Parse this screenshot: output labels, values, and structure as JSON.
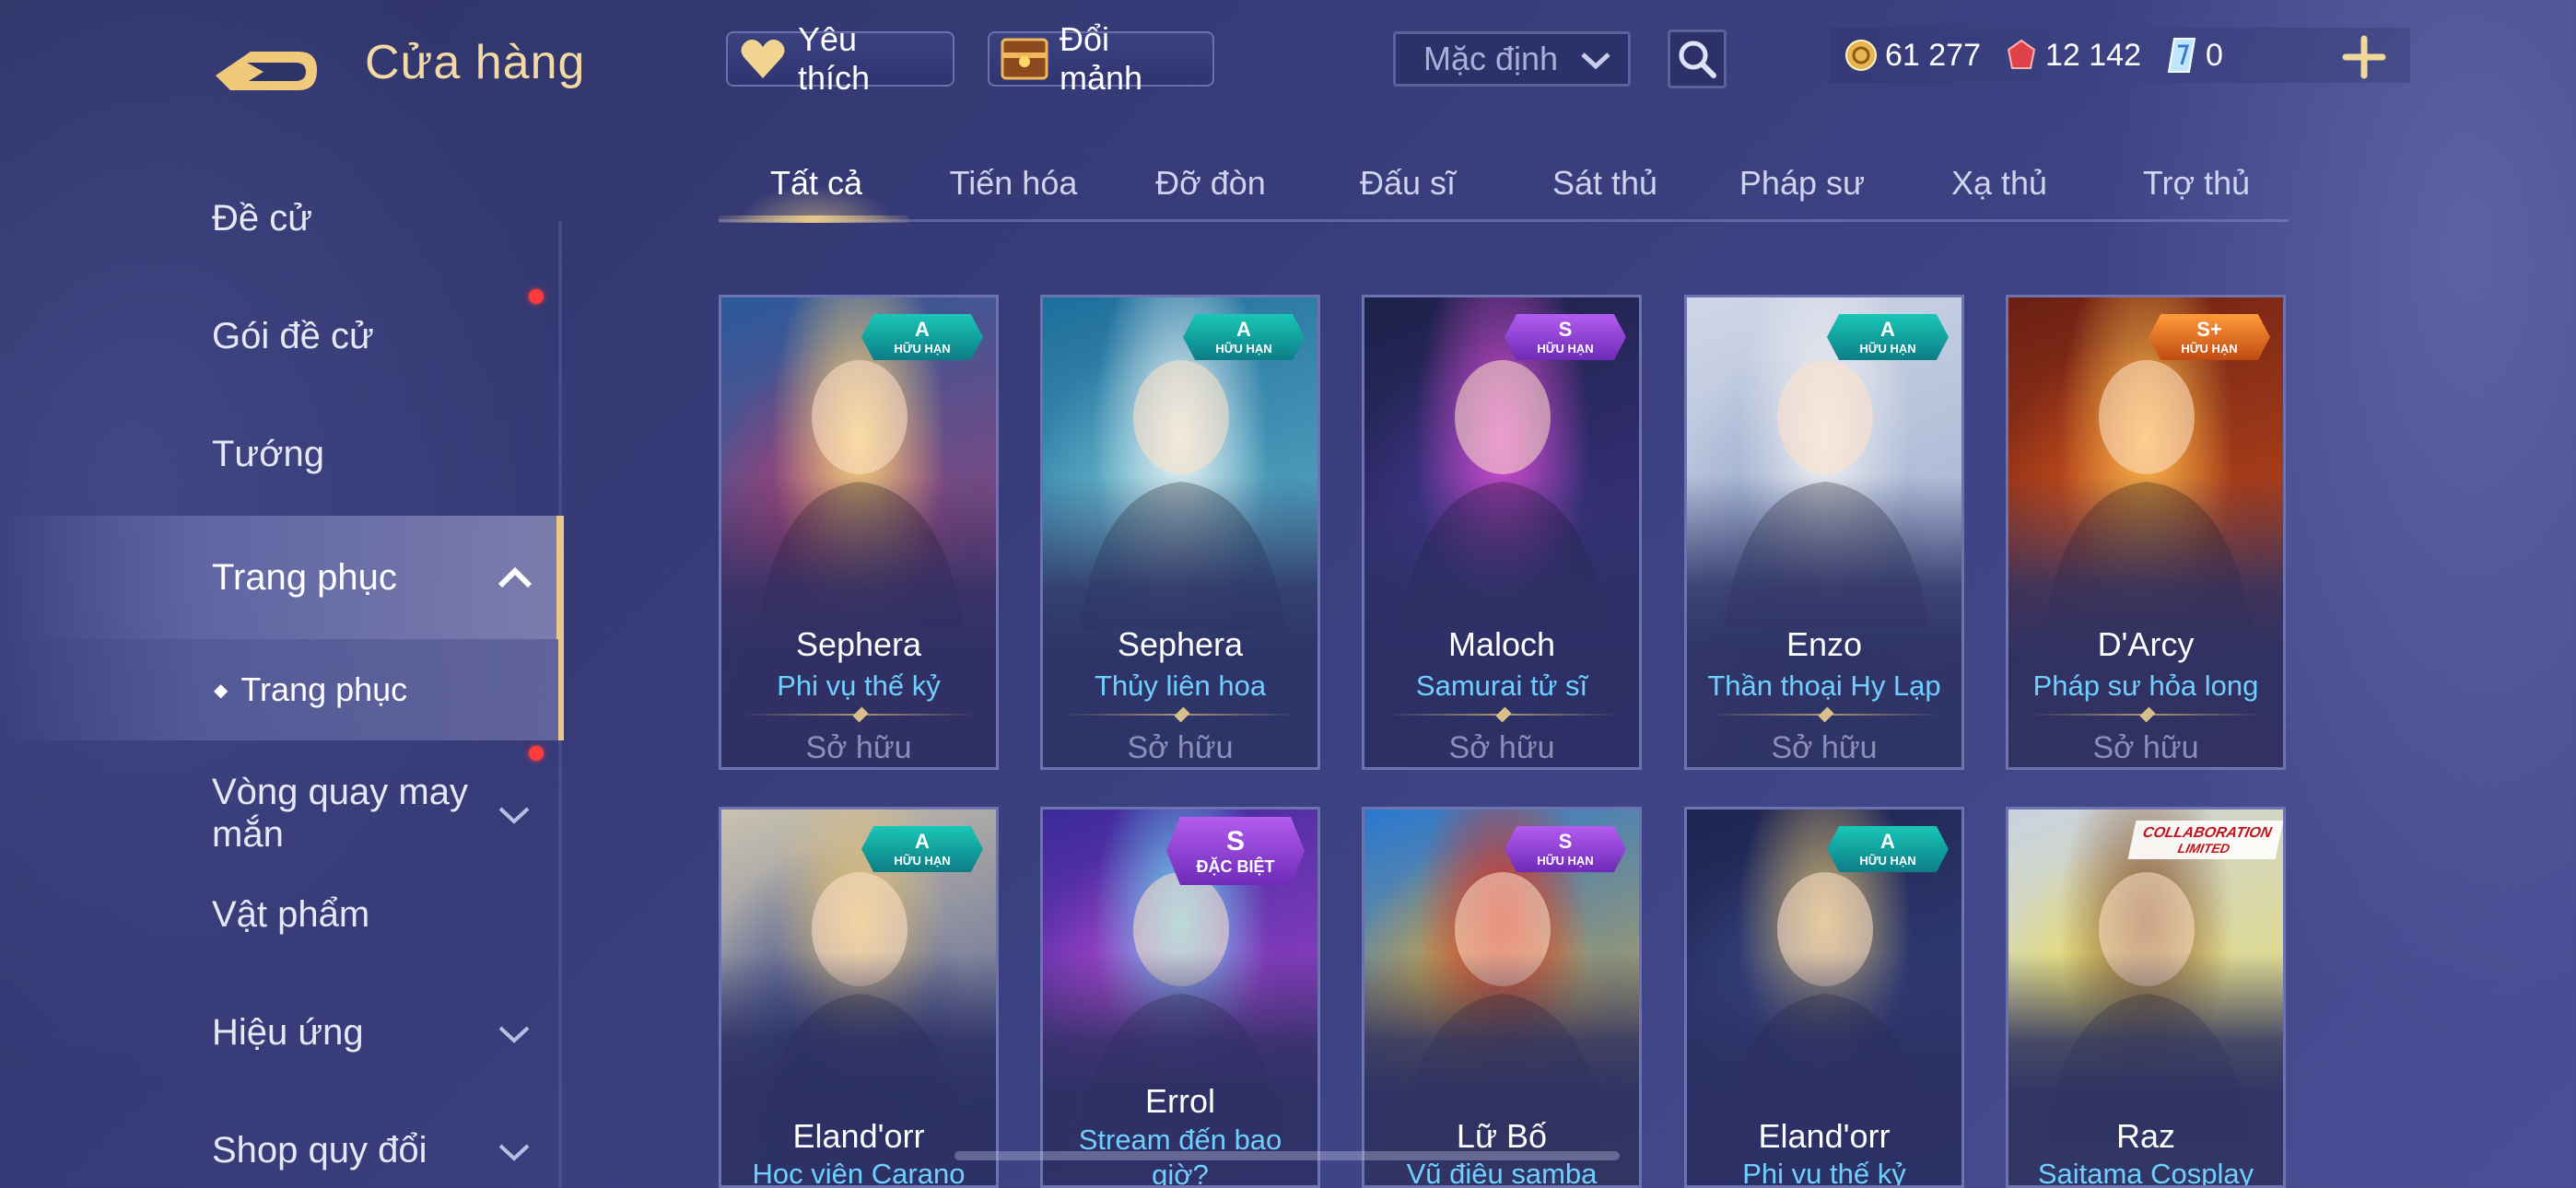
{
  "header": {
    "title": "Cửa hàng",
    "favorites_label": "Yêu thích",
    "exchange_label": "Đổi mảnh",
    "sort_value": "Mặc định"
  },
  "currency": {
    "gold": "61 277",
    "vouchers": "12 142",
    "quan_huy": "0"
  },
  "sidebar": {
    "items": [
      {
        "label": "Đề cử"
      },
      {
        "label": "Gói đề cử"
      },
      {
        "label": "Tướng"
      },
      {
        "label": "Trang phục"
      },
      {
        "label": "Vòng quay may mắn"
      },
      {
        "label": "Vật phẩm"
      },
      {
        "label": "Hiệu ứng"
      },
      {
        "label": "Shop quy đổi"
      }
    ],
    "sub_item": "Trang phục",
    "sub_bullet": "◆"
  },
  "tabs": [
    "Tất cả",
    "Tiến hóa",
    "Đỡ đòn",
    "Đấu sĩ",
    "Sát thủ",
    "Pháp sư",
    "Xạ thủ",
    "Trợ thủ"
  ],
  "cards": [
    {
      "hero": "Sephera",
      "skin": "Phi vụ thế kỷ",
      "status": "Sở hữu",
      "grade": "A",
      "tag": "HỮU HẠN",
      "badge_color": "teal",
      "art": [
        "#2a5a9c",
        "#c23a6b",
        "#f2d37a"
      ]
    },
    {
      "hero": "Sephera",
      "skin": "Thủy liên hoa",
      "status": "Sở hữu",
      "grade": "A",
      "tag": "HỮU HẠN",
      "badge_color": "teal",
      "art": [
        "#1e6e9c",
        "#78c6d6",
        "#e6f2f4"
      ]
    },
    {
      "hero": "Maloch",
      "skin": "Samurai tử sĩ",
      "status": "Sở hữu",
      "grade": "S",
      "tag": "HỮU HẠN",
      "badge_color": "purple",
      "art": [
        "#1c2148",
        "#4a3a9a",
        "#d44ad0"
      ]
    },
    {
      "hero": "Enzo",
      "skin": "Thần thoại Hy Lạp",
      "status": "Sở hữu",
      "grade": "A",
      "tag": "HỮU HẠN",
      "badge_color": "teal",
      "art": [
        "#cfd6e6",
        "#8ea2c8",
        "#f2f2f4"
      ]
    },
    {
      "hero": "D'Arcy",
      "skin": "Pháp sư hỏa long",
      "status": "Sở hữu",
      "grade": "S+",
      "tag": "HỮU HẠN",
      "badge_color": "orange",
      "art": [
        "#6b1f14",
        "#e05a1e",
        "#f6b54a"
      ]
    },
    {
      "hero": "Eland'orr",
      "skin": "Học viện Carano",
      "status": "",
      "grade": "A",
      "tag": "HỮU HẠN",
      "badge_color": "teal",
      "art": [
        "#c9c2b0",
        "#3b4a8a",
        "#e3c276"
      ]
    },
    {
      "hero": "Errol",
      "skin": "Stream đến bao giờ?",
      "status": "",
      "grade": "S",
      "tag": "ĐẶC BIỆT",
      "badge_color": "purple",
      "art": [
        "#3a2a9a",
        "#c24ad6",
        "#6ad0f0"
      ]
    },
    {
      "hero": "Lữ Bố",
      "skin": "Vũ điệu samba",
      "status": "",
      "grade": "S",
      "tag": "HỮU HẠN",
      "badge_color": "purple",
      "art": [
        "#2a78d0",
        "#f0b02a",
        "#d0302a"
      ]
    },
    {
      "hero": "Eland'orr",
      "skin": "Phi vụ thế kỷ",
      "status": "",
      "grade": "A",
      "tag": "HỮU HẠN",
      "badge_color": "teal",
      "art": [
        "#1e2450",
        "#3a4a8a",
        "#c9b070"
      ]
    },
    {
      "hero": "Raz",
      "skin": "Saitama Cosplay",
      "status": "",
      "grade": "COLLABORATION",
      "tag": "LIMITED",
      "badge_color": "collab",
      "art": [
        "#c9d2e2",
        "#f2e24a",
        "#8a5a3a"
      ]
    }
  ],
  "colors": {
    "accent_gold": "#e7c98b",
    "skin_name_blue": "#6fd0ff",
    "background": "#373b78",
    "notification_red": "#ff3b3b"
  }
}
